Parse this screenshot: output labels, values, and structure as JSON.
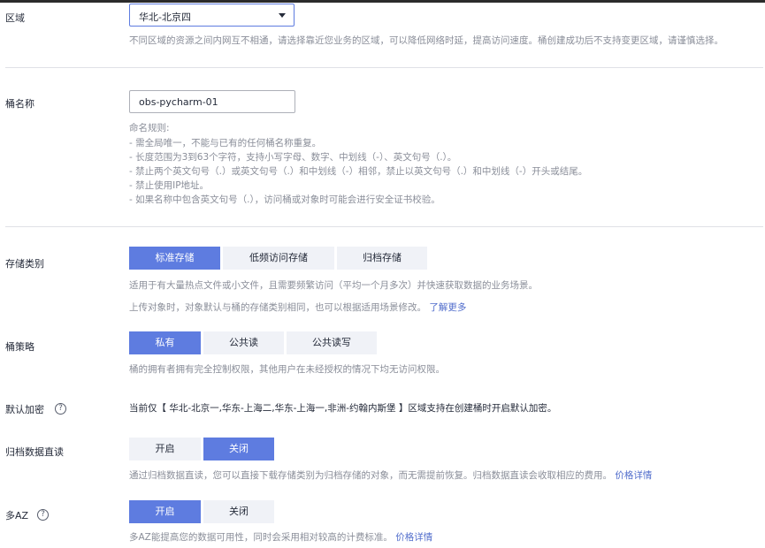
{
  "region": {
    "label": "区域",
    "selected": "华北-北京四",
    "hint": "不同区域的资源之间内网互不相通，请选择靠近您业务的区域，可以降低网络时延，提高访问速度。桶创建成功后不支持变更区域，请谨慎选择。"
  },
  "bucket_name": {
    "label": "桶名称",
    "value": "obs-pycharm-01",
    "rules_title": "命名规则:",
    "rules": [
      "- 需全局唯一，不能与已有的任何桶名称重复。",
      "- 长度范围为3到63个字符，支持小写字母、数字、中划线（-）、英文句号（.）。",
      "- 禁止两个英文句号（.）或英文句号（.）和中划线（-）相邻，禁止以英文句号（.）和中划线（-）开头或结尾。",
      "- 禁止使用IP地址。",
      "- 如果名称中包含英文句号（.），访问桶或对象时可能会进行安全证书校验。"
    ]
  },
  "storage_class": {
    "label": "存储类别",
    "options": [
      "标准存储",
      "低频访问存储",
      "归档存储"
    ],
    "selected": "标准存储",
    "hint1": "适用于有大量热点文件或小文件，且需要频繁访问（平均一个月多次）并快速获取数据的业务场景。",
    "hint2": "上传对象时，对象默认与桶的存储类别相同，也可以根据适用场景修改。",
    "learn_more": "了解更多"
  },
  "bucket_policy": {
    "label": "桶策略",
    "options": [
      "私有",
      "公共读",
      "公共读写"
    ],
    "selected": "私有",
    "hint": "桶的拥有者拥有完全控制权限，其他用户在未经授权的情况下均无访问权限。"
  },
  "default_encryption": {
    "label": "默认加密",
    "help": "?",
    "text": "当前仅【 华北-北京一,华东-上海二,华东-上海一,非洲-约翰内斯堡 】区域支持在创建桶时开启默认加密。"
  },
  "archive_direct_read": {
    "label": "归档数据直读",
    "options": [
      "开启",
      "关闭"
    ],
    "selected": "关闭",
    "hint": "通过归档数据直读，您可以直接下载存储类别为归档存储的对象，而无需提前恢复。归档数据直读会收取相应的费用。",
    "price_link": "价格详情"
  },
  "multi_az": {
    "label": "多AZ",
    "help": "?",
    "options": [
      "开启",
      "关闭"
    ],
    "selected": "开启",
    "hint": "多AZ能提高您的数据可用性，同时会采用相对较高的计费标准。",
    "price_link": "价格详情"
  },
  "colors": {
    "accent": "#5e7ce0",
    "segment_off": "#f0f2f7",
    "hint_text": "#8a8e99",
    "link": "#526ecc"
  }
}
